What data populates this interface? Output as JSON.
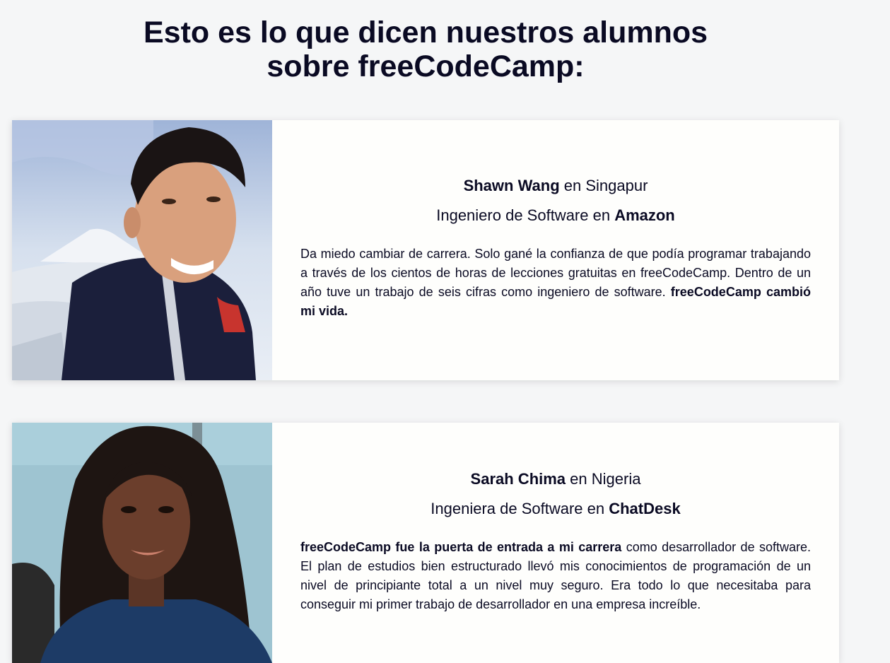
{
  "page": {
    "heading_line1": "Esto es lo que dicen nuestros alumnos",
    "heading_line2": "sobre freeCodeCamp:"
  },
  "testimonials": [
    {
      "name": "Shawn Wang",
      "location_prefix": " en ",
      "location": "Singapur",
      "role_prefix": "Ingeniero de Software en ",
      "company": "Amazon",
      "quote_parts": [
        {
          "text": "Da miedo cambiar de carrera. Solo gané la confianza de que podía programar trabajando a través de los cientos de horas de lecciones gratuitas en freeCodeCamp. Dentro de un año tuve un trabajo de seis cifras como ingeniero de software. ",
          "bold": false
        },
        {
          "text": "freeCodeCamp cambió mi vida.",
          "bold": true
        }
      ]
    },
    {
      "name": "Sarah Chima",
      "location_prefix": " en ",
      "location": "Nigeria",
      "role_prefix": "Ingeniera de Software en ",
      "company": "ChatDesk",
      "quote_parts": [
        {
          "text": "freeCodeCamp fue la puerta de entrada a mi carrera",
          "bold": true
        },
        {
          "text": " como desarrollador de software. El plan de estudios bien estructurado llevó mis conocimientos de programación de un nivel de principiante total a un nivel muy seguro. Era todo lo que necesitaba para conseguir mi primer trabajo de desarrollador en una empresa increíble.",
          "bold": false
        }
      ]
    }
  ],
  "colors": {
    "background": "#f5f6f7",
    "card": "#fefefc",
    "text": "#0a0a23"
  }
}
